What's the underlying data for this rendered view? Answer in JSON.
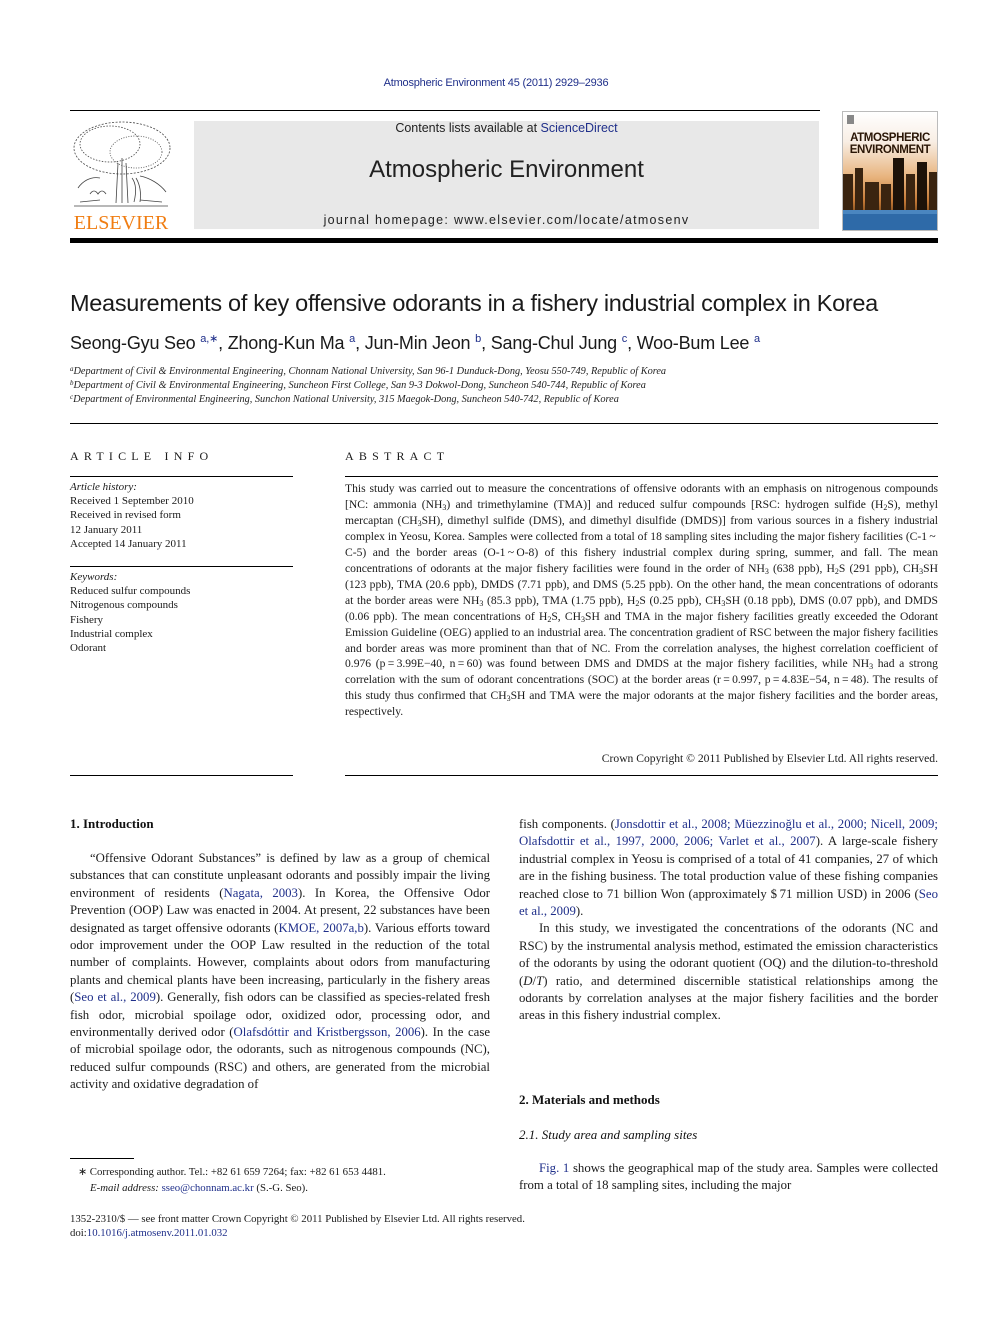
{
  "citation": "Atmospheric Environment 45 (2011) 2929–2936",
  "header": {
    "publisher_wordmark": "ELSEVIER",
    "contents_prefix": "Contents lists available at ",
    "contents_link": "ScienceDirect",
    "journal_title": "Atmospheric Environment",
    "homepage": "journal homepage: www.elsevier.com/locate/atmosenv",
    "cover_title_line1": "ATMOSPHERIC",
    "cover_title_line2": "ENVIRONMENT",
    "brand_color": "#f07d12",
    "link_color": "#1f2f8a"
  },
  "article": {
    "title": "Measurements of key offensive odorants in a fishery industrial complex in Korea",
    "authors": [
      {
        "name": "Seong-Gyu Seo",
        "sup": "a,∗",
        "sep": ", "
      },
      {
        "name": "Zhong-Kun Ma",
        "sup": "a",
        "sep": ", "
      },
      {
        "name": "Jun-Min Jeon",
        "sup": "b",
        "sep": ", "
      },
      {
        "name": "Sang-Chul Jung",
        "sup": "c",
        "sep": ", "
      },
      {
        "name": "Woo-Bum Lee",
        "sup": "a",
        "sep": ""
      }
    ],
    "affiliations": [
      {
        "mark": "a",
        "text": "Department of Civil & Environmental Engineering, Chonnam National University, San 96-1 Dunduck-Dong, Yeosu 550-749, Republic of Korea"
      },
      {
        "mark": "b",
        "text": "Department of Civil & Environmental Engineering, Suncheon First College, San 9-3 Dokwol-Dong, Suncheon 540-744, Republic of Korea"
      },
      {
        "mark": "c",
        "text": "Department of Environmental Engineering, Sunchon National University, 315 Maegok-Dong, Suncheon 540-742, Republic of Korea"
      }
    ]
  },
  "article_info": {
    "heading": "ARTICLE INFO",
    "history_label": "Article history:",
    "history": [
      "Received 1 September 2010",
      "Received in revised form",
      "12 January 2011",
      "Accepted 14 January 2011"
    ],
    "keywords_label": "Keywords:",
    "keywords": [
      "Reduced sulfur compounds",
      "Nitrogenous compounds",
      "Fishery",
      "Industrial complex",
      "Odorant"
    ]
  },
  "abstract": {
    "heading": "ABSTRACT",
    "segments": [
      "This study was carried out to measure the concentrations of offensive odorants with an emphasis on nitrogenous compounds [NC: ammonia (NH",
      "3",
      ") and trimethylamine (TMA)] and reduced sulfur compounds [RSC: hydrogen sulfide (H",
      "2",
      "S), methyl mercaptan (CH",
      "3",
      "SH), dimethyl sulfide (DMS), and dimethyl disulfide (DMDS)] from various sources in a fishery industrial complex in Yeosu, Korea. Samples were collected from a total of 18 sampling sites including the major fishery facilities (C-1 ~ C-5) and the border areas (O-1 ~ O-8) of this fishery industrial complex during spring, summer, and fall. The mean concentrations of odorants at the major fishery facilities were found in the order of NH",
      "3",
      " (638 ppb), H",
      "2",
      "S (291 ppb), CH",
      "3",
      "SH (123 ppb), TMA (20.6 ppb), DMDS (7.71 ppb), and DMS (5.25 ppb). On the other hand, the mean concentrations of odorants at the border areas were NH",
      "3",
      " (85.3 ppb), TMA (1.75 ppb), H",
      "2",
      "S (0.25 ppb), CH",
      "3",
      "SH (0.18 ppb), DMS (0.07 ppb), and DMDS (0.06 ppb). The mean concentrations of H",
      "2",
      "S, CH",
      "3",
      "SH and TMA in the major fishery facilities greatly exceeded the Odorant Emission Guideline (OEG) applied to an industrial area. The concentration gradient of RSC between the major fishery facilities and border areas was more prominent than that of NC. From the correlation analyses, the highest correlation coefficient of 0.976 (p = 3.99E−40, n = 60) was found between DMS and DMDS at the major fishery facilities, while NH",
      "3",
      " had a strong correlation with the sum of odorant concentrations (SOC) at the border areas (r = 0.997, p = 4.83E−54, n = 48). The results of this study thus confirmed that CH",
      "3",
      "SH and TMA were the major odorants at the major fishery facilities and the border areas, respectively."
    ],
    "copyright": "Crown Copyright © 2011 Published by Elsevier Ltd. All rights reserved."
  },
  "sections": {
    "intro_heading": "1.  Introduction",
    "intro_p1": [
      {
        "t": "“Offensive Odorant Substances” is defined by law as a group of chemical substances that can constitute unpleasant odorants and possibly impair the living environment of residents ("
      },
      {
        "t": "Nagata, 2003",
        "link": true
      },
      {
        "t": "). In Korea, the Offensive Odor Prevention (OOP) Law was enacted in 2004. At present, 22 substances have been designated as target offensive odorants ("
      },
      {
        "t": "KMOE, 2007a,b",
        "link": true
      },
      {
        "t": "). Various efforts toward odor improvement under the OOP Law resulted in the reduction of the total number of complaints. However, complaints about odors from manufacturing plants and chemical plants have been increasing, particularly in the fishery areas ("
      },
      {
        "t": "Seo et al., 2009",
        "link": true
      },
      {
        "t": "). Generally, fish odors can be classified as species-related fresh fish odor, microbial spoilage odor, oxidized odor, processing odor, and environmentally derived odor ("
      },
      {
        "t": "Olafsdóttir and Kristbergsson, 2006",
        "link": true
      },
      {
        "t": "). In the case of microbial spoilage odor, the odorants, such as nitrogenous compounds (NC), reduced sulfur compounds (RSC) and others, are generated from the microbial activity and oxidative degradation of"
      }
    ],
    "intro_p1_cont": [
      {
        "t": "fish components. ("
      },
      {
        "t": "Jonsdottir et al., 2008; Müezzinoğlu et al., 2000; Nicell, 2009; Olafsdottir et al., 1997, 2000, 2006; Varlet et al., 2007",
        "link": true
      },
      {
        "t": "). A large-scale fishery industrial complex in Yeosu is comprised of a total of 41 companies, 27 of which are in the fishing business. The total production value of these fishing companies reached close to 71 billion Won (approximately $ 71 million USD) in 2006 ("
      },
      {
        "t": "Seo et al., 2009",
        "link": true
      },
      {
        "t": ")."
      }
    ],
    "intro_p2": "In this study, we investigated the concentrations of the odorants (NC and RSC) by the instrumental analysis method, estimated the emission characteristics of the odorants by using the odorant quotient (OQ) and the dilution-to-threshold (D/T) ratio, and determined discernible statistical relationships among the odorants by correlation analyses at the major fishery facilities and the border areas in this fishery industrial complex.",
    "methods_heading": "2.  Materials and methods",
    "study_heading": "2.1.  Study area and sampling sites",
    "study_p1": [
      {
        "t": "Fig. 1",
        "link": true
      },
      {
        "t": " shows the geographical map of the study area. Samples were collected from a total of 18 sampling sites, including the major"
      }
    ]
  },
  "footnote": {
    "line1": "∗  Corresponding author. Tel.: +82 61 659 7264; fax: +82 61 653 4481.",
    "email_label": "E-mail address: ",
    "email": "sseo@chonnam.ac.kr",
    "email_suffix": " (S.-G. Seo)."
  },
  "front_matter": {
    "issn_line": "1352-2310/$ — see front matter Crown Copyright © 2011 Published by Elsevier Ltd. All rights reserved.",
    "doi_label": "doi:",
    "doi": "10.1016/j.atmosenv.2011.01.032"
  }
}
